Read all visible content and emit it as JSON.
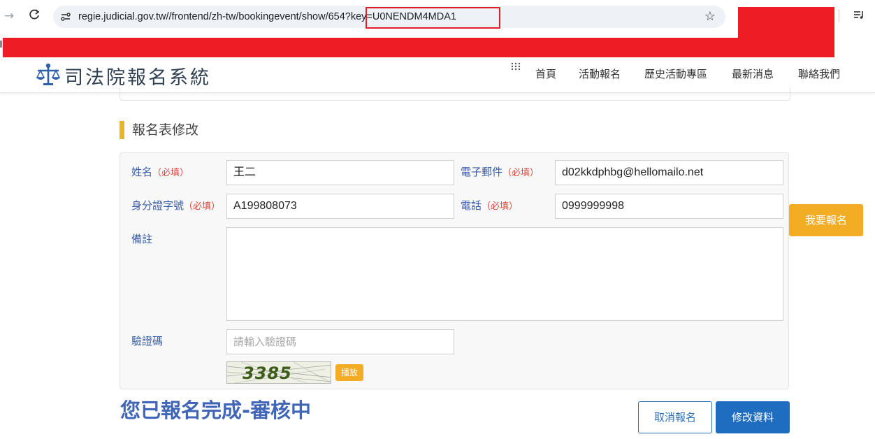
{
  "browser": {
    "url": "regie.judicial.gov.tw//frontend/zh-tw/bookingevent/show/654?key=U0NENDM4MDA1"
  },
  "header": {
    "site_title": "司法院報名系統",
    "nav": [
      "首頁",
      "活動報名",
      "歷史活動專區",
      "最新消息",
      "聯絡我們"
    ]
  },
  "form": {
    "section_title": "報名表修改",
    "required_mark": "（必填）",
    "name": {
      "label": "姓名",
      "value": "王二"
    },
    "email": {
      "label": "電子郵件",
      "value": "d02kkdphbg@hellomailo.net"
    },
    "id_number": {
      "label": "身分證字號",
      "value": "A199808073"
    },
    "phone": {
      "label": "電話",
      "value": "0999999998"
    },
    "remarks": {
      "label": "備註",
      "value": ""
    },
    "captcha": {
      "label": "驗證碼",
      "placeholder": "請輸入驗證碼",
      "image_text": "3385",
      "play_label": "播放"
    }
  },
  "status_message": "您已報名完成-審核中",
  "buttons": {
    "cancel": "取消報名",
    "edit": "修改資料",
    "register": "我要報名"
  },
  "colors": {
    "accent_yellow": "#f2ad25",
    "primary_blue": "#1f6dc1",
    "label_blue": "#3a5fa8",
    "required_red": "#e0473b",
    "redaction_red": "#ee1c25"
  }
}
